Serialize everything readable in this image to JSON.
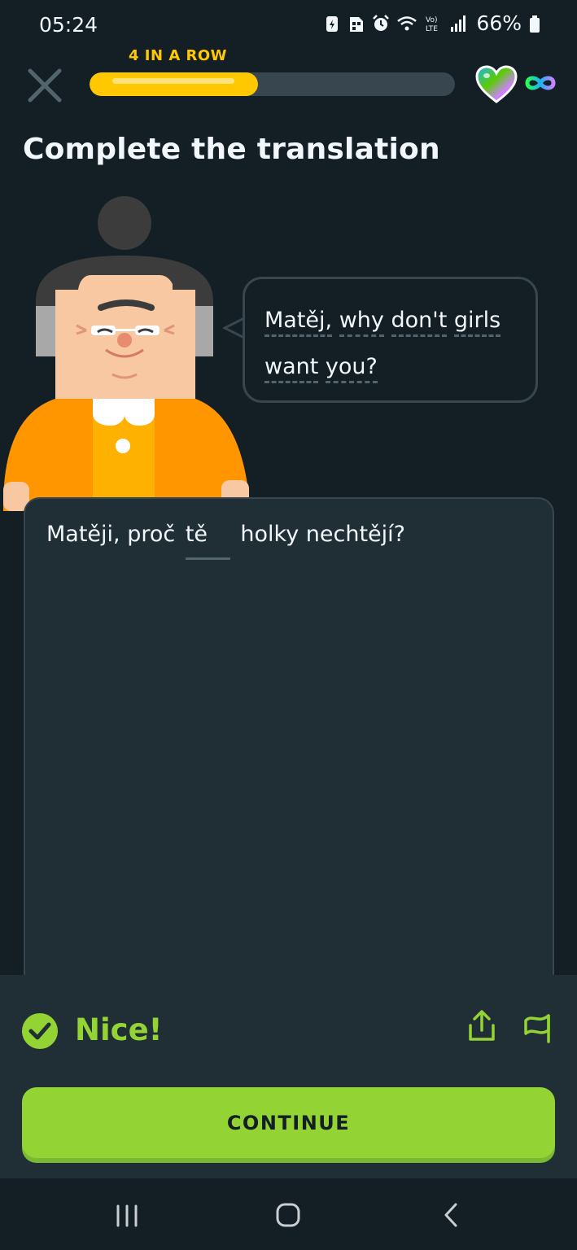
{
  "status_bar": {
    "time": "05:24",
    "battery": "66%",
    "icons": [
      "battery-saver-icon",
      "sim-icon",
      "alarm-icon",
      "wifi-icon",
      "volte-icon",
      "signal-icon",
      "battery-icon"
    ]
  },
  "header": {
    "streak_label": "4 IN A ROW",
    "progress": 0.46,
    "progress_color": "#ffc800",
    "hearts": "infinity"
  },
  "title": "Complete the translation",
  "prompt": {
    "line1_words": [
      "Matěj,",
      "why",
      "don't",
      "girls"
    ],
    "line2_words": [
      "want",
      "you?"
    ]
  },
  "answer": {
    "before": "Matěji, proč",
    "filled": "tě",
    "after": "holky nechtějí?"
  },
  "feedback": {
    "label": "Nice!",
    "color": "#93d333",
    "continue_label": "CONTINUE"
  },
  "nav": {
    "icons": [
      "recent-apps-icon",
      "home-icon",
      "back-icon"
    ]
  }
}
